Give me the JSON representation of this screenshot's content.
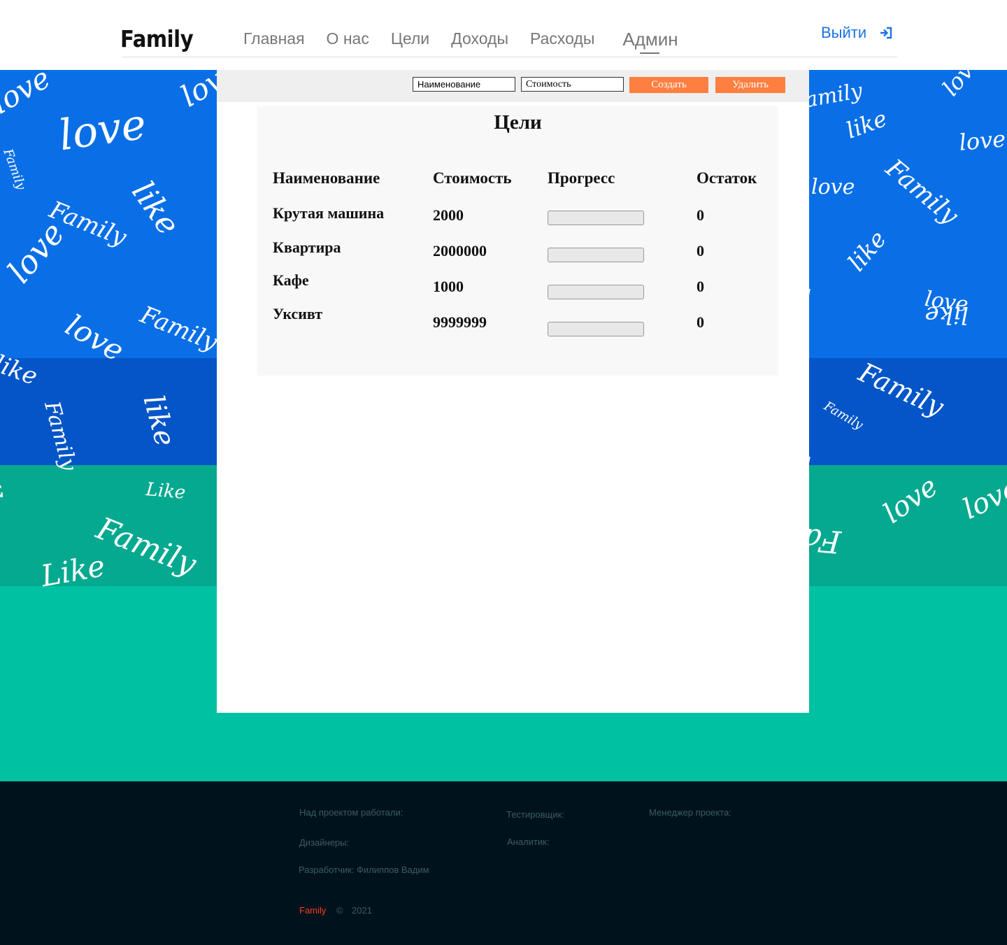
{
  "header": {
    "logo": "Family",
    "nav": [
      "Главная",
      "О нас",
      "Цели",
      "Доходы",
      "Расходы",
      "Админ"
    ],
    "logout_label": "Выйти",
    "logout_icon": "sign-in-icon",
    "accent_color": "#1a73e8"
  },
  "toolbar": {
    "name_value": "Наименование",
    "cost_value": "Стоимость",
    "create_label": "Создать",
    "delete_label": "Удалить",
    "button_color": "#ff7f40"
  },
  "goals": {
    "title": "Цели",
    "columns": [
      "Наименование",
      "Стоимость",
      "Прогресс",
      "Остаток"
    ],
    "rows": [
      {
        "name": "Крутая машина",
        "cost": "2000",
        "progress": 0,
        "remainder": "0"
      },
      {
        "name": "Квартира",
        "cost": "2000000",
        "progress": 0,
        "remainder": "0"
      },
      {
        "name": "Кафе",
        "cost": "1000",
        "progress": 0,
        "remainder": "0"
      },
      {
        "name": "Уксивт",
        "cost": "9999999",
        "progress": 0,
        "remainder": "0"
      }
    ]
  },
  "background_words": [
    "love",
    "like",
    "Family",
    "Like"
  ],
  "footer": {
    "worked_on": "Над проектом работали:",
    "designers": "Дизайнеры:",
    "developer": "Разработчик: Филиппов Вадим",
    "tester": "Тестировщик:",
    "analyst": "Аналитик:",
    "manager": "Менеджер проекта:",
    "brand": "Family",
    "copyright": "©",
    "year": "2021"
  }
}
